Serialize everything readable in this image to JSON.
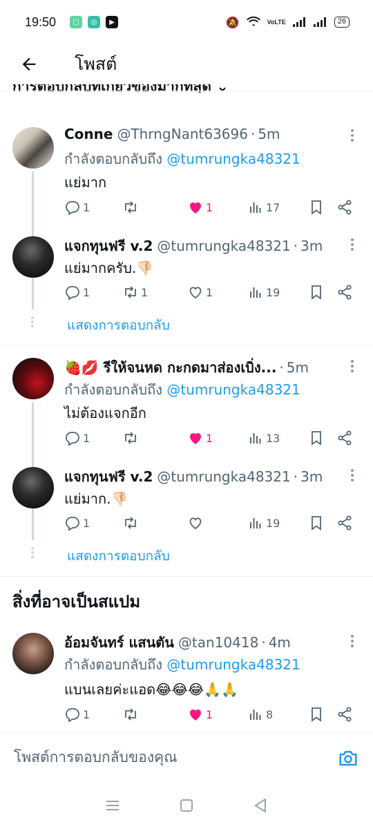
{
  "status": {
    "time": "19:50",
    "network": "VoLTE",
    "battery": "26"
  },
  "header": {
    "title": "โพสต์"
  },
  "sort_peek": "การตอบกลับที่เกี่ยวข้องมากที่สุด ⌄",
  "colors": {
    "accent": "#1d9bf0",
    "like": "#f91880",
    "muted": "#536471"
  },
  "threads": [
    {
      "tweets": [
        {
          "name": "Conne",
          "handle": "@ThrngNant63696",
          "time": "5m",
          "reply_label": "กำลังตอบกลับถึง",
          "reply_mention": "@tumrungka48321",
          "text": "แย่มาก",
          "counts": {
            "reply": "1",
            "repost": "",
            "like": "1",
            "views": "17"
          },
          "liked": true
        },
        {
          "name": "แจกทุนฟรี v.2",
          "handle": "@tumrungka48321",
          "time": "3m",
          "text": "แย่มากครับ.👎🏻",
          "counts": {
            "reply": "1",
            "repost": "1",
            "like": "1",
            "views": "19"
          },
          "liked": false
        }
      ],
      "show_replies": "แสดงการตอบกลับ"
    },
    {
      "tweets": [
        {
          "name": "🍓💋 รีให้จนหด กะกดมาส่องเบิ่ง...",
          "handle": "",
          "time": "5m",
          "reply_label": "กำลังตอบกลับถึง",
          "reply_mention": "@tumrungka48321",
          "text": "ไม่ต้องแจกอีก",
          "counts": {
            "reply": "1",
            "repost": "",
            "like": "1",
            "views": "13"
          },
          "liked": true
        },
        {
          "name": "แจกทุนฟรี v.2",
          "handle": "@tumrungka48321",
          "time": "3m",
          "text": "แย่มาก.👎🏻",
          "counts": {
            "reply": "1",
            "repost": "",
            "like": "",
            "views": "19"
          },
          "liked": false
        }
      ],
      "show_replies": "แสดงการตอบกลับ"
    }
  ],
  "spam_section": {
    "title": "สิ่งที่อาจเป็นสแปม",
    "tweet": {
      "name": "อ้อมจันทร์ แสนตัน",
      "handle": "@tan10418",
      "time": "4m",
      "reply_label": "กำลังตอบกลับถึง",
      "reply_mention": "@tumrungka48321",
      "text": "แบนเลยค่ะแอด😂😂😂🙏🙏",
      "counts": {
        "reply": "1",
        "repost": "",
        "like": "1",
        "views": "8"
      },
      "liked": true
    }
  },
  "reply_bar": {
    "placeholder": "โพสต์การตอบกลับของคุณ"
  },
  "icons": [
    "back-arrow-icon",
    "more-icon",
    "reply-icon",
    "repost-icon",
    "heart-icon",
    "views-icon",
    "bookmark-icon",
    "share-icon",
    "camera-icon",
    "menu-icon",
    "home-icon",
    "back-icon"
  ]
}
